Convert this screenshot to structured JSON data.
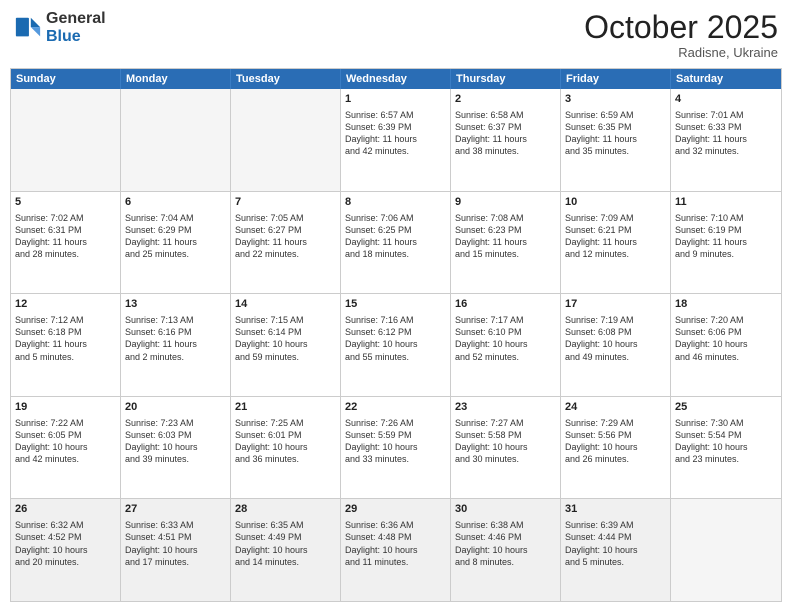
{
  "header": {
    "logo": {
      "general": "General",
      "blue": "Blue"
    },
    "month": "October 2025",
    "location": "Radisne, Ukraine"
  },
  "days_of_week": [
    "Sunday",
    "Monday",
    "Tuesday",
    "Wednesday",
    "Thursday",
    "Friday",
    "Saturday"
  ],
  "weeks": [
    [
      {
        "day": "",
        "text": "",
        "empty": true
      },
      {
        "day": "",
        "text": "",
        "empty": true
      },
      {
        "day": "",
        "text": "",
        "empty": true
      },
      {
        "day": "1",
        "text": "Sunrise: 6:57 AM\nSunset: 6:39 PM\nDaylight: 11 hours\nand 42 minutes."
      },
      {
        "day": "2",
        "text": "Sunrise: 6:58 AM\nSunset: 6:37 PM\nDaylight: 11 hours\nand 38 minutes."
      },
      {
        "day": "3",
        "text": "Sunrise: 6:59 AM\nSunset: 6:35 PM\nDaylight: 11 hours\nand 35 minutes."
      },
      {
        "day": "4",
        "text": "Sunrise: 7:01 AM\nSunset: 6:33 PM\nDaylight: 11 hours\nand 32 minutes."
      }
    ],
    [
      {
        "day": "5",
        "text": "Sunrise: 7:02 AM\nSunset: 6:31 PM\nDaylight: 11 hours\nand 28 minutes."
      },
      {
        "day": "6",
        "text": "Sunrise: 7:04 AM\nSunset: 6:29 PM\nDaylight: 11 hours\nand 25 minutes."
      },
      {
        "day": "7",
        "text": "Sunrise: 7:05 AM\nSunset: 6:27 PM\nDaylight: 11 hours\nand 22 minutes."
      },
      {
        "day": "8",
        "text": "Sunrise: 7:06 AM\nSunset: 6:25 PM\nDaylight: 11 hours\nand 18 minutes."
      },
      {
        "day": "9",
        "text": "Sunrise: 7:08 AM\nSunset: 6:23 PM\nDaylight: 11 hours\nand 15 minutes."
      },
      {
        "day": "10",
        "text": "Sunrise: 7:09 AM\nSunset: 6:21 PM\nDaylight: 11 hours\nand 12 minutes."
      },
      {
        "day": "11",
        "text": "Sunrise: 7:10 AM\nSunset: 6:19 PM\nDaylight: 11 hours\nand 9 minutes."
      }
    ],
    [
      {
        "day": "12",
        "text": "Sunrise: 7:12 AM\nSunset: 6:18 PM\nDaylight: 11 hours\nand 5 minutes."
      },
      {
        "day": "13",
        "text": "Sunrise: 7:13 AM\nSunset: 6:16 PM\nDaylight: 11 hours\nand 2 minutes."
      },
      {
        "day": "14",
        "text": "Sunrise: 7:15 AM\nSunset: 6:14 PM\nDaylight: 10 hours\nand 59 minutes."
      },
      {
        "day": "15",
        "text": "Sunrise: 7:16 AM\nSunset: 6:12 PM\nDaylight: 10 hours\nand 55 minutes."
      },
      {
        "day": "16",
        "text": "Sunrise: 7:17 AM\nSunset: 6:10 PM\nDaylight: 10 hours\nand 52 minutes."
      },
      {
        "day": "17",
        "text": "Sunrise: 7:19 AM\nSunset: 6:08 PM\nDaylight: 10 hours\nand 49 minutes."
      },
      {
        "day": "18",
        "text": "Sunrise: 7:20 AM\nSunset: 6:06 PM\nDaylight: 10 hours\nand 46 minutes."
      }
    ],
    [
      {
        "day": "19",
        "text": "Sunrise: 7:22 AM\nSunset: 6:05 PM\nDaylight: 10 hours\nand 42 minutes."
      },
      {
        "day": "20",
        "text": "Sunrise: 7:23 AM\nSunset: 6:03 PM\nDaylight: 10 hours\nand 39 minutes."
      },
      {
        "day": "21",
        "text": "Sunrise: 7:25 AM\nSunset: 6:01 PM\nDaylight: 10 hours\nand 36 minutes."
      },
      {
        "day": "22",
        "text": "Sunrise: 7:26 AM\nSunset: 5:59 PM\nDaylight: 10 hours\nand 33 minutes."
      },
      {
        "day": "23",
        "text": "Sunrise: 7:27 AM\nSunset: 5:58 PM\nDaylight: 10 hours\nand 30 minutes."
      },
      {
        "day": "24",
        "text": "Sunrise: 7:29 AM\nSunset: 5:56 PM\nDaylight: 10 hours\nand 26 minutes."
      },
      {
        "day": "25",
        "text": "Sunrise: 7:30 AM\nSunset: 5:54 PM\nDaylight: 10 hours\nand 23 minutes."
      }
    ],
    [
      {
        "day": "26",
        "text": "Sunrise: 6:32 AM\nSunset: 4:52 PM\nDaylight: 10 hours\nand 20 minutes."
      },
      {
        "day": "27",
        "text": "Sunrise: 6:33 AM\nSunset: 4:51 PM\nDaylight: 10 hours\nand 17 minutes."
      },
      {
        "day": "28",
        "text": "Sunrise: 6:35 AM\nSunset: 4:49 PM\nDaylight: 10 hours\nand 14 minutes."
      },
      {
        "day": "29",
        "text": "Sunrise: 6:36 AM\nSunset: 4:48 PM\nDaylight: 10 hours\nand 11 minutes."
      },
      {
        "day": "30",
        "text": "Sunrise: 6:38 AM\nSunset: 4:46 PM\nDaylight: 10 hours\nand 8 minutes."
      },
      {
        "day": "31",
        "text": "Sunrise: 6:39 AM\nSunset: 4:44 PM\nDaylight: 10 hours\nand 5 minutes."
      },
      {
        "day": "",
        "text": "",
        "empty": true
      }
    ]
  ]
}
